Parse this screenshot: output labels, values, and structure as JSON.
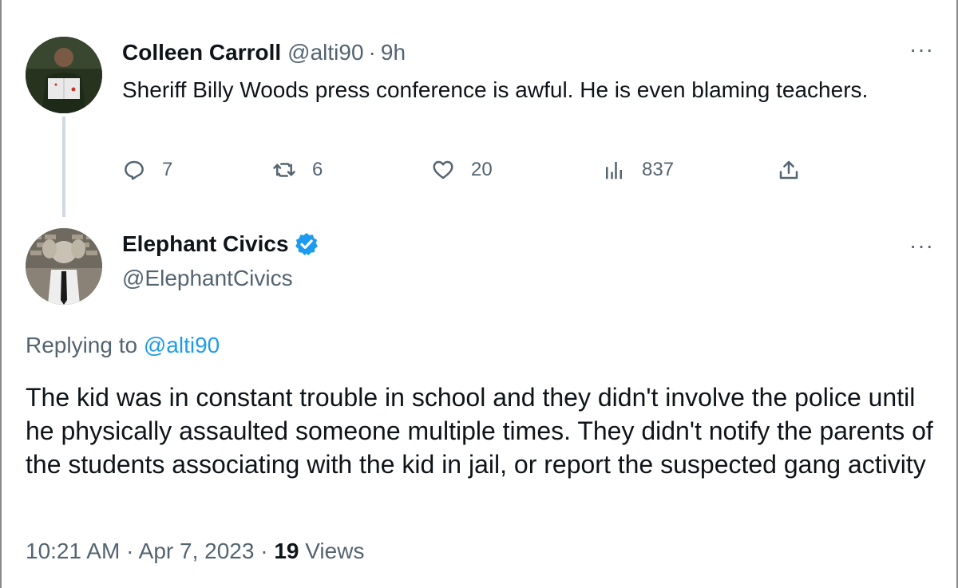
{
  "tweet1": {
    "display_name": "Colleen Carroll",
    "handle": "@alti90",
    "separator": "·",
    "time": "9h",
    "more": "···",
    "text": "Sheriff Billy Woods press conference is awful. He is even blaming teachers.",
    "actions": {
      "reply_count": "7",
      "retweet_count": "6",
      "like_count": "20",
      "views_count": "837"
    }
  },
  "tweet2": {
    "display_name": "Elephant Civics",
    "handle": "@ElephantCivics",
    "more": "···",
    "replying_prefix": "Replying to",
    "replying_handle": "@alti90",
    "text": "The kid was in constant trouble in school and they didn't involve the police until he physically assaulted someone multiple times. They didn't notify the parents of the students associating with the kid in jail, or report the suspected gang activity",
    "time": "10:21 AM",
    "date": "Apr 7, 2023",
    "separator": "·",
    "views_count": "19",
    "views_label": "Views"
  },
  "colors": {
    "text_primary": "#0f1419",
    "text_secondary": "#536471",
    "link": "#1d9bf0",
    "verified": "#1d9bf0"
  },
  "icons": [
    "reply-icon",
    "retweet-icon",
    "like-icon",
    "views-icon",
    "share-icon",
    "verified-badge-icon"
  ]
}
